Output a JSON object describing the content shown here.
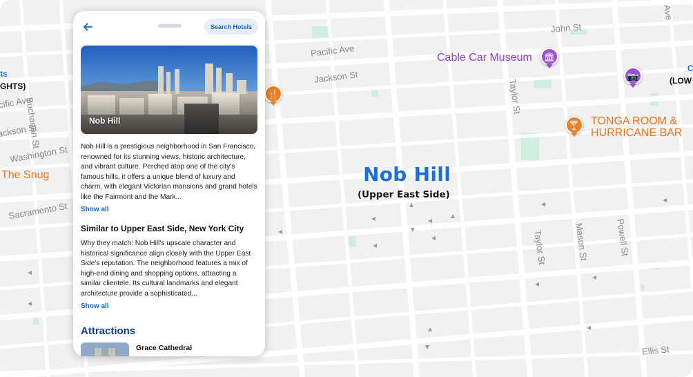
{
  "map": {
    "streets": {
      "john": "John St",
      "pacific_left": "Pacific Ave",
      "pacific_mid": "Pacific Ave",
      "jackson_left": "Jackson St",
      "jackson_mid": "Jackson St",
      "washington": "Washington St",
      "sacramento": "Sacramento St",
      "buchanan": "Buchanan St",
      "taylor_top": "Taylor St",
      "taylor_bottom": "Taylor St",
      "mason": "Mason St",
      "powell": "Powell St",
      "ellis": "Ellis St",
      "ave_top_right": "Ave"
    },
    "pois": {
      "cable_car_museum": "Cable Car Museum",
      "tonga_room_line1": "TONGA ROOM &",
      "tonga_room_line2": "HURRICANE BAR",
      "the_snug": "The Snug"
    },
    "edge_labels": {
      "left_ts": "ts",
      "left_ghts": "GHTS)",
      "right_low": "(LOW",
      "right_blue": "C"
    },
    "neighborhood": {
      "name": "Nob Hill",
      "subtitle": "(Upper East Side)"
    },
    "icons": {
      "museum_pin": "museum-icon",
      "camera_pin": "camera-icon",
      "cocktail_pin": "cocktail-icon",
      "restaurant_pin": "restaurant-icon"
    }
  },
  "panel": {
    "search_button": "Search Hotels",
    "hero_title": "Nob Hill",
    "description": "Nob Hill is a prestigious neighborhood in San Francisco, renowned for its stunning views, historic architecture, and vibrant culture. Perched atop one of the city's famous hills, it offers a unique blend of luxury and charm, with elegant Victorian mansions and grand hotels like the Fairmont and the Mark...",
    "show_all_1": "Show all",
    "similar_title": "Similar to Upper East Side, New York City",
    "similar_text": "Why they match: Nob Hill's upscale character and historical significance align closely with the Upper East Side's reputation. The neighborhood features a mix of high-end dining and shopping options, attracting a similar clientele. Its cultural landmarks and elegant architecture provide a sophisticated...",
    "show_all_2": "Show all",
    "attractions_title": "Attractions",
    "attractions": [
      {
        "name": "Grace Cathedral"
      }
    ]
  },
  "colors": {
    "accent_blue": "#1565c0",
    "neighborhood_blue": "#1a6fe0",
    "poi_purple": "#8d3fcf",
    "poi_orange": "#e8711d",
    "attractions_navy": "#0d3f87"
  }
}
